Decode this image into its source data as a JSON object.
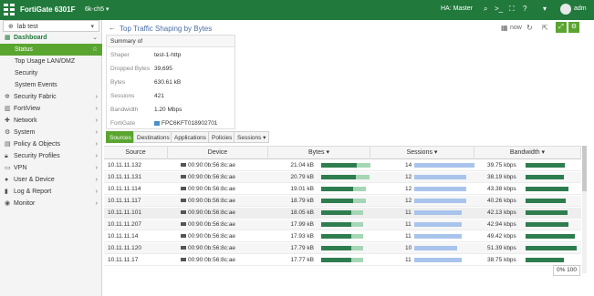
{
  "app": {
    "title": "FortiGate 6301F",
    "vdom": "6k-ch5",
    "ha_status": "HA: Master",
    "user": "adm"
  },
  "sidebar": {
    "vdom_select": "lab test",
    "items": [
      {
        "label": "Dashboard",
        "icon": "dashboard-icon",
        "expanded": true
      },
      {
        "label": "Status",
        "active": true
      },
      {
        "label": "Top Usage LAN/DMZ"
      },
      {
        "label": "Security"
      },
      {
        "label": "System Events"
      },
      {
        "label": "Security Fabric",
        "icon": "fabric-icon"
      },
      {
        "label": "FortiView",
        "icon": "fortiview-icon"
      },
      {
        "label": "Network",
        "icon": "network-icon"
      },
      {
        "label": "System",
        "icon": "gear-icon"
      },
      {
        "label": "Policy & Objects",
        "icon": "policy-icon"
      },
      {
        "label": "Security Profiles",
        "icon": "lock-icon"
      },
      {
        "label": "VPN",
        "icon": "vpn-icon"
      },
      {
        "label": "User & Device",
        "icon": "user-icon"
      },
      {
        "label": "Log & Report",
        "icon": "log-icon"
      },
      {
        "label": "Monitor",
        "icon": "monitor-icon"
      }
    ]
  },
  "page": {
    "title": "Top Traffic Shaping by Bytes",
    "refresh_label": "now"
  },
  "summary": {
    "header": "Summary of",
    "rows": [
      {
        "key": "Shaper",
        "value": "test-1-http"
      },
      {
        "key": "Dropped Bytes",
        "value": "39,695"
      },
      {
        "key": "Bytes",
        "value": "630.61 kB"
      },
      {
        "key": "Sessions",
        "value": "421"
      },
      {
        "key": "Bandwidth",
        "value": "1.20 Mbps"
      },
      {
        "key": "FortiGate",
        "value": "FPC6KFT018902701"
      }
    ]
  },
  "tabs": [
    "Sources",
    "Destinations",
    "Applications",
    "Policies",
    "Sessions"
  ],
  "table": {
    "columns": [
      "Source",
      "Device",
      "Bytes",
      "Sessions",
      "Bandwidth"
    ],
    "rows": [
      {
        "source": "10.11.11.132",
        "device": "00:90:0b:56:8c:ae",
        "bytes": "21.04 kB",
        "sessions": "14",
        "bandwidth": "39.75 kbps"
      },
      {
        "source": "10.11.11.131",
        "device": "00:90:0b:56:8c:ae",
        "bytes": "20.79 kB",
        "sessions": "12",
        "bandwidth": "38.19 kbps"
      },
      {
        "source": "10.11.11.114",
        "device": "00:90:0b:56:8c:ae",
        "bytes": "19.01 kB",
        "sessions": "12",
        "bandwidth": "43.38 kbps"
      },
      {
        "source": "10.11.11.117",
        "device": "00:90:0b:56:8c:ae",
        "bytes": "18.79 kB",
        "sessions": "12",
        "bandwidth": "40.26 kbps"
      },
      {
        "source": "10.11.11.101",
        "device": "00:90:0b:56:8c:ae",
        "bytes": "18.05 kB",
        "sessions": "11",
        "bandwidth": "42.13 kbps"
      },
      {
        "source": "10.11.11.207",
        "device": "00:90:0b:56:8c:ae",
        "bytes": "17.99 kB",
        "sessions": "11",
        "bandwidth": "42.94 kbps"
      },
      {
        "source": "10.11.11.14",
        "device": "00:90:0b:56:8c:ae",
        "bytes": "17.93 kB",
        "sessions": "11",
        "bandwidth": "49.42 kbps"
      },
      {
        "source": "10.11.11.120",
        "device": "00:90:0b:56:8c:ae",
        "bytes": "17.79 kB",
        "sessions": "10",
        "bandwidth": "51.39 kbps"
      },
      {
        "source": "10.11.11.17",
        "device": "00:90:0b:56:8c:ae",
        "bytes": "17.77 kB",
        "sessions": "11",
        "bandwidth": "38.75 kbps"
      }
    ]
  },
  "zoom_label": "0% 100",
  "colors": {
    "topbar": "#217a3c",
    "accent": "#5aa530",
    "bar_dark": "#2e7d4f",
    "bar_light": "#a5d6b5",
    "bar_blue": "#a9c4ec"
  }
}
